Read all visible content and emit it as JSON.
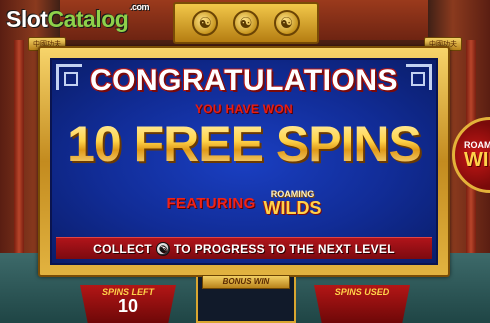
{
  "logo": {
    "part1": "Slot",
    "part2": "Catalog",
    "suffix": ".com"
  },
  "top_banner": {
    "icons": [
      "yin-yang-icon",
      "yin-yang-icon",
      "yin-yang-icon"
    ],
    "glyph": "☯"
  },
  "plaques": {
    "left": "中國功夫",
    "right": "中國功夫"
  },
  "popup": {
    "title": "CONGRATULATIONS",
    "subtitle": "YOU HAVE WON",
    "award": "10 FREE SPINS",
    "featuring": "FEATURING",
    "feature_top": "ROAMING",
    "feature_bottom": "WILDS",
    "collect_before": "COLLECT",
    "collect_after": "TO PROGRESS TO THE NEXT LEVEL"
  },
  "side_badge": {
    "top": "ROAM",
    "bottom": "WIL"
  },
  "counters": {
    "spins_left_label": "SPINS LEFT",
    "spins_left_value": "10",
    "bonus_win_label": "BONUS WIN",
    "spins_used_label": "SPINS USED"
  },
  "colors": {
    "gold": "#f2c84a",
    "panel_blue": "#112c96",
    "accent_red": "#e81d14",
    "logo_green": "#8ed14a"
  }
}
